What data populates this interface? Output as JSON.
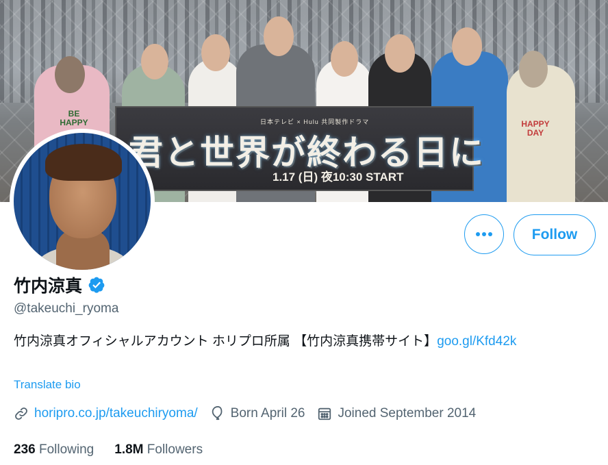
{
  "banner": {
    "sign_small_text": "日本テレビ × Hulu 共同製作ドラマ",
    "sign_title": "君と世界が終わる日に",
    "sign_date": "1.17 (日) 夜10:30 START",
    "shirt_left": "BE HAPPY",
    "shirt_right": "HAPPY DAY"
  },
  "actions": {
    "more_label": "•••",
    "follow_label": "Follow"
  },
  "profile": {
    "display_name": "竹内涼真",
    "handle": "@takeuchi_ryoma",
    "bio_text": "竹内涼真オフィシャルアカウント ホリプロ所属 【竹内涼真携帯サイト】",
    "bio_link": "goo.gl/Kfd42k",
    "translate_label": "Translate bio",
    "website": "horipro.co.jp/takeuchiryoma/",
    "birthday": "Born April 26",
    "joined": "Joined September 2014"
  },
  "stats": {
    "following_count": "236",
    "following_label": "Following",
    "followers_count": "1.8M",
    "followers_label": "Followers"
  },
  "colors": {
    "accent": "#1d9bf0",
    "secondary_text": "#536471",
    "primary_text": "#0f1419"
  },
  "icons": {
    "verified": "verified-badge-icon",
    "link": "link-icon",
    "birthday": "balloon-icon",
    "joined": "calendar-icon",
    "more": "more-dots-icon"
  }
}
